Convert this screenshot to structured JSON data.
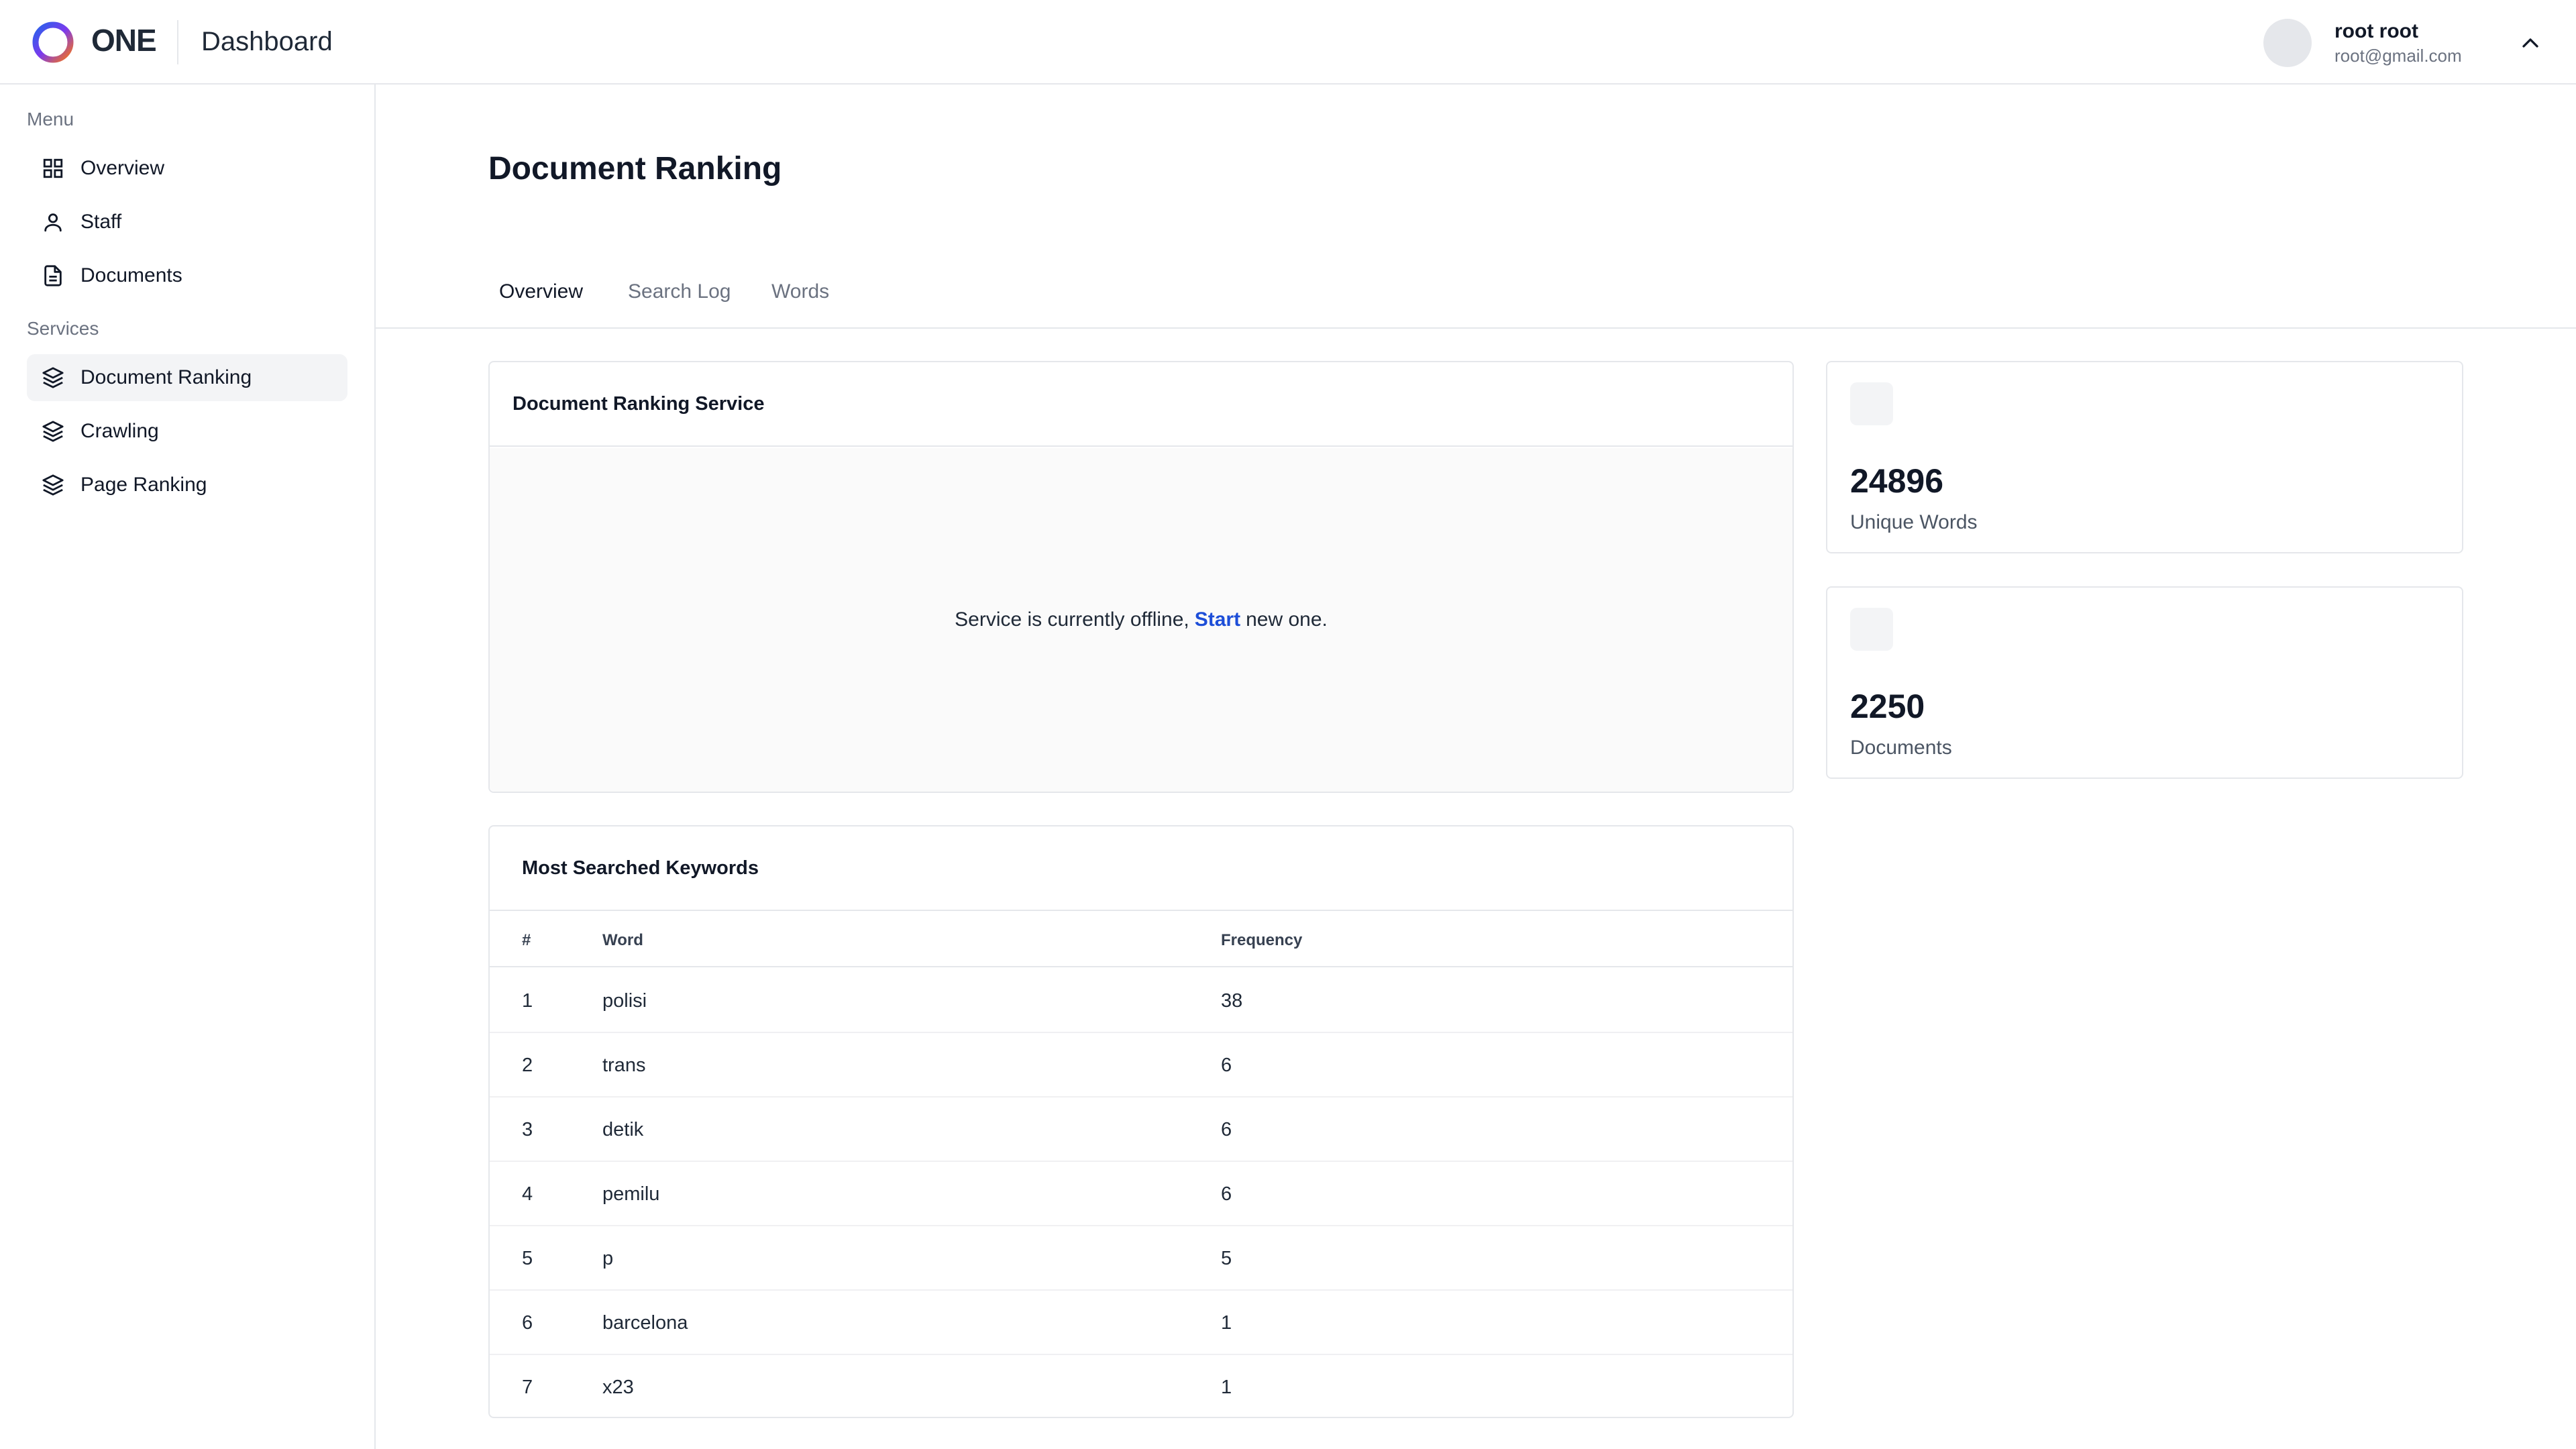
{
  "header": {
    "brand": "ONE",
    "title": "Dashboard",
    "user": {
      "name": "root root",
      "email": "root@gmail.com"
    }
  },
  "sidebar": {
    "menu_label": "Menu",
    "menu_items": [
      {
        "label": "Overview",
        "icon": "grid-icon"
      },
      {
        "label": "Staff",
        "icon": "user-icon"
      },
      {
        "label": "Documents",
        "icon": "document-icon"
      }
    ],
    "services_label": "Services",
    "service_items": [
      {
        "label": "Document Ranking",
        "icon": "layers-icon",
        "active": true
      },
      {
        "label": "Crawling",
        "icon": "layers-icon"
      },
      {
        "label": "Page Ranking",
        "icon": "layers-icon"
      }
    ]
  },
  "main": {
    "page_title": "Document Ranking",
    "tabs": [
      {
        "label": "Overview",
        "active": true
      },
      {
        "label": "Search Log"
      },
      {
        "label": "Words"
      }
    ],
    "service_card": {
      "title": "Document Ranking Service",
      "message_before": "Service is currently offline,",
      "link": "Start",
      "message_after": "new one."
    },
    "stats": [
      {
        "value": "24896",
        "label": "Unique Words"
      },
      {
        "value": "2250",
        "label": "Documents"
      }
    ],
    "keywords": {
      "title": "Most Searched Keywords",
      "columns": [
        "#",
        "Word",
        "Frequency"
      ],
      "rows": [
        {
          "rank": "1",
          "word": "polisi",
          "frequency": "38"
        },
        {
          "rank": "2",
          "word": "trans",
          "frequency": "6"
        },
        {
          "rank": "3",
          "word": "detik",
          "frequency": "6"
        },
        {
          "rank": "4",
          "word": "pemilu",
          "frequency": "6"
        },
        {
          "rank": "5",
          "word": "p",
          "frequency": "5"
        },
        {
          "rank": "6",
          "word": "barcelona",
          "frequency": "1"
        },
        {
          "rank": "7",
          "word": "x23",
          "frequency": "1"
        }
      ]
    }
  },
  "colors": {
    "accent_link": "#1d4ed8",
    "active_nav_bg": "#f3f4f6",
    "border": "#e5e7eb"
  }
}
